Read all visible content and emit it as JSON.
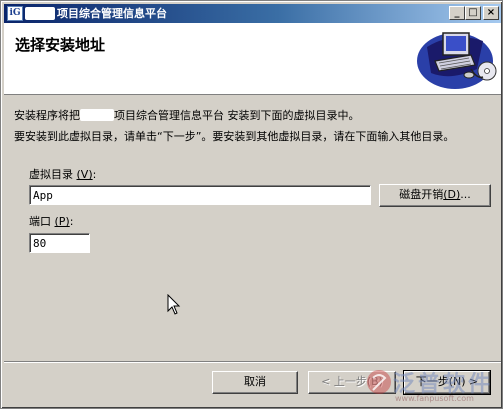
{
  "window": {
    "icon_text": "iG",
    "title": "项目综合管理信息平台",
    "minimize": "_",
    "maximize": "□",
    "close": "×"
  },
  "header": {
    "title": "选择安装地址"
  },
  "body": {
    "intro_prefix": "安装程序将把",
    "intro_suffix": "项目综合管理信息平台 安装到下面的虚拟目录中。",
    "instruction": "要安装到此虚拟目录，请单击“下一步”。要安装到其他虚拟目录，请在下面输入其他目录。"
  },
  "vdir": {
    "label": "虚拟目录",
    "hotkey": "(V)",
    "colon": ":",
    "value": "App",
    "disk_cost_label": "磁盘开销",
    "disk_cost_hotkey": "(D)",
    "disk_cost_suffix": "..."
  },
  "port": {
    "label": "端口",
    "hotkey": "(P)",
    "colon": ":",
    "value": "80"
  },
  "footer": {
    "cancel": "取消",
    "back": "< 上一步(B)",
    "next": "下一步(N) >"
  },
  "watermark": {
    "text": "泛普软件",
    "url": "www.fanpusoft.com"
  },
  "colors": {
    "titlebar_start": "#0a246a",
    "titlebar_end": "#a6caf0",
    "window_bg": "#d4d0c8"
  }
}
